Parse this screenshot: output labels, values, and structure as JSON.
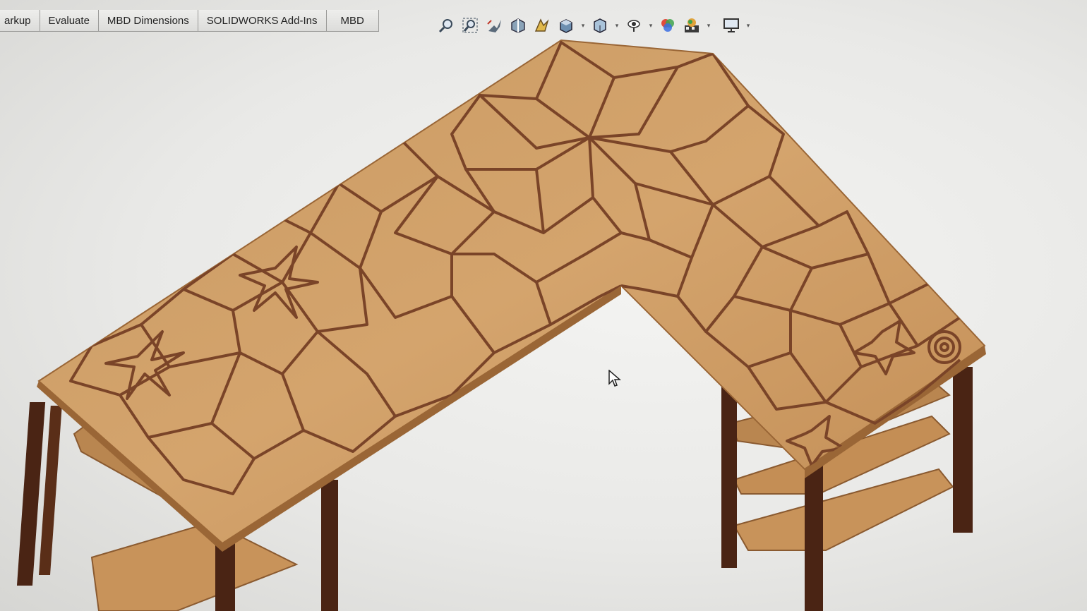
{
  "command_manager": {
    "tabs": [
      {
        "label": "arkup"
      },
      {
        "label": "Evaluate"
      },
      {
        "label": "MBD Dimensions"
      },
      {
        "label": "SOLIDWORKS Add-Ins"
      },
      {
        "label": "MBD"
      }
    ]
  },
  "heads_up_toolbar": {
    "buttons": [
      {
        "icon": "zoom-to-fit-icon"
      },
      {
        "icon": "zoom-to-area-icon"
      },
      {
        "icon": "previous-view-icon"
      },
      {
        "icon": "section-view-icon"
      },
      {
        "icon": "dynamic-annotation-icon"
      },
      {
        "icon": "view-orientation-icon",
        "has_dropdown": true
      },
      {
        "icon": "display-style-icon",
        "has_dropdown": true
      },
      {
        "icon": "hide-show-items-icon",
        "has_dropdown": true
      },
      {
        "icon": "edit-appearance-icon"
      },
      {
        "icon": "apply-scene-icon",
        "has_dropdown": true
      },
      {
        "icon": "view-settings-icon",
        "has_dropdown": true
      }
    ]
  },
  "model": {
    "name": "L-shaped desk with geometric tabletop pattern",
    "colors": {
      "top_light": "#d8a870",
      "top_mid": "#c48e55",
      "top_dark": "#a8743e",
      "pattern_line": "#7a4428",
      "leg": "#4a2414",
      "shelf": "#c8935a",
      "edge": "#8a5a30"
    }
  }
}
